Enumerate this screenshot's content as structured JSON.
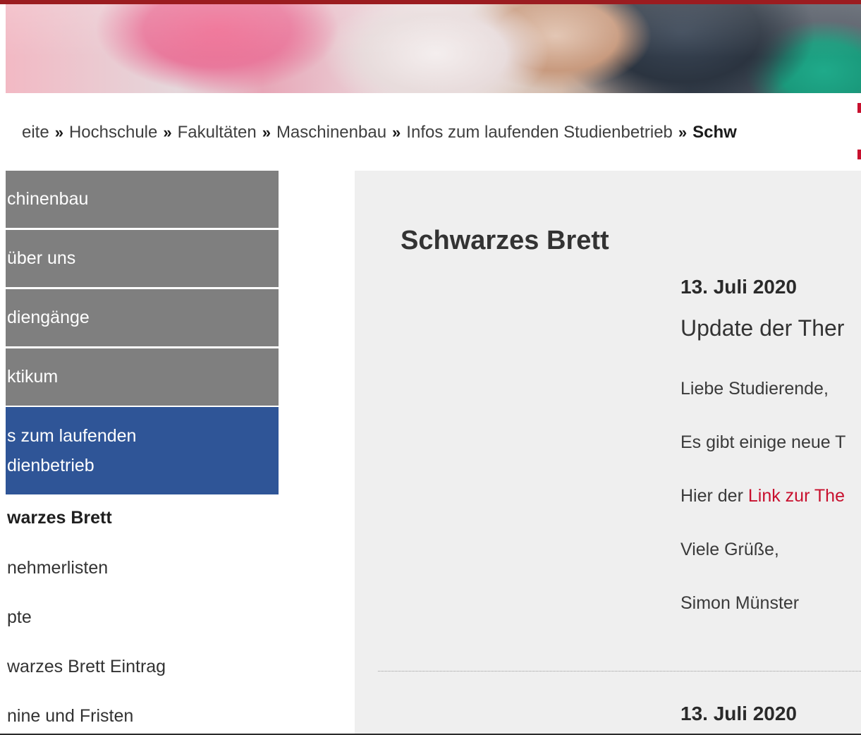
{
  "breadcrumb": {
    "items": [
      "eite",
      "Hochschule",
      "Fakultäten",
      "Maschinenbau",
      "Infos zum laufenden Studienbetrieb"
    ],
    "current": "Schw",
    "separator": "»"
  },
  "sidebar": {
    "main_items": [
      "chinenbau",
      "über uns",
      "diengänge",
      "ktikum"
    ],
    "active_item": {
      "line1": "s zum laufenden",
      "line2": "dienbetrieb"
    },
    "sub_items": [
      "warzes Brett",
      "nehmerlisten",
      "pte",
      "warzes Brett Eintrag",
      "nine und Fristen"
    ],
    "active_sub_index": 0
  },
  "main": {
    "title": "Schwarzes Brett",
    "post": {
      "date": "13. Juli 2020",
      "title": "Update der Ther",
      "greeting": "Liebe Studierende,",
      "body": "Es gibt einige neue T",
      "link_prefix": "Hier der ",
      "link_text": "Link zur The",
      "closing": "Viele Grüße,",
      "author": "Simon Münster"
    },
    "next_post_date": "13. Juli 2020"
  },
  "colors": {
    "brand_red": "#c8102e",
    "top_bar": "#9b1c20",
    "nav_gray": "#7f7f7f",
    "nav_active": "#2f5597",
    "content_bg": "#efefef"
  }
}
